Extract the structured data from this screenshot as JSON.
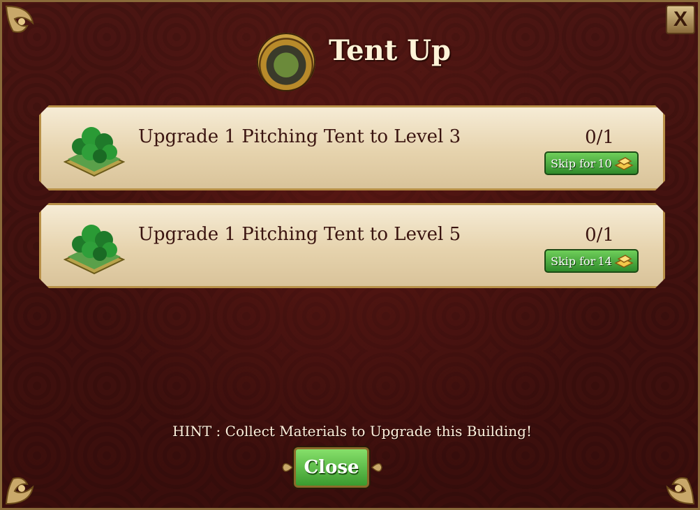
{
  "dialog": {
    "title": "Tent Up",
    "close_x_label": "X",
    "icon": "tent-building-medal-icon"
  },
  "tasks": [
    {
      "label": "Upgrade 1 Pitching Tent to Level 3",
      "progress": "0/1",
      "skip_text": "Skip for",
      "skip_cost": "10",
      "icon": "forest-tile-icon",
      "currency_icon": "gold-bars-icon"
    },
    {
      "label": "Upgrade 1 Pitching Tent to Level 5",
      "progress": "0/1",
      "skip_text": "Skip for",
      "skip_cost": "14",
      "icon": "forest-tile-icon",
      "currency_icon": "gold-bars-icon"
    }
  ],
  "footer": {
    "hint": "HINT : Collect Materials to Upgrade this Building!",
    "close_label": "Close"
  },
  "colors": {
    "background": "#3a0e0c",
    "parchment": "#efe0c2",
    "gold_trim": "#b89048",
    "button_green": "#3a9a2e",
    "title_text": "#fff4d8"
  }
}
